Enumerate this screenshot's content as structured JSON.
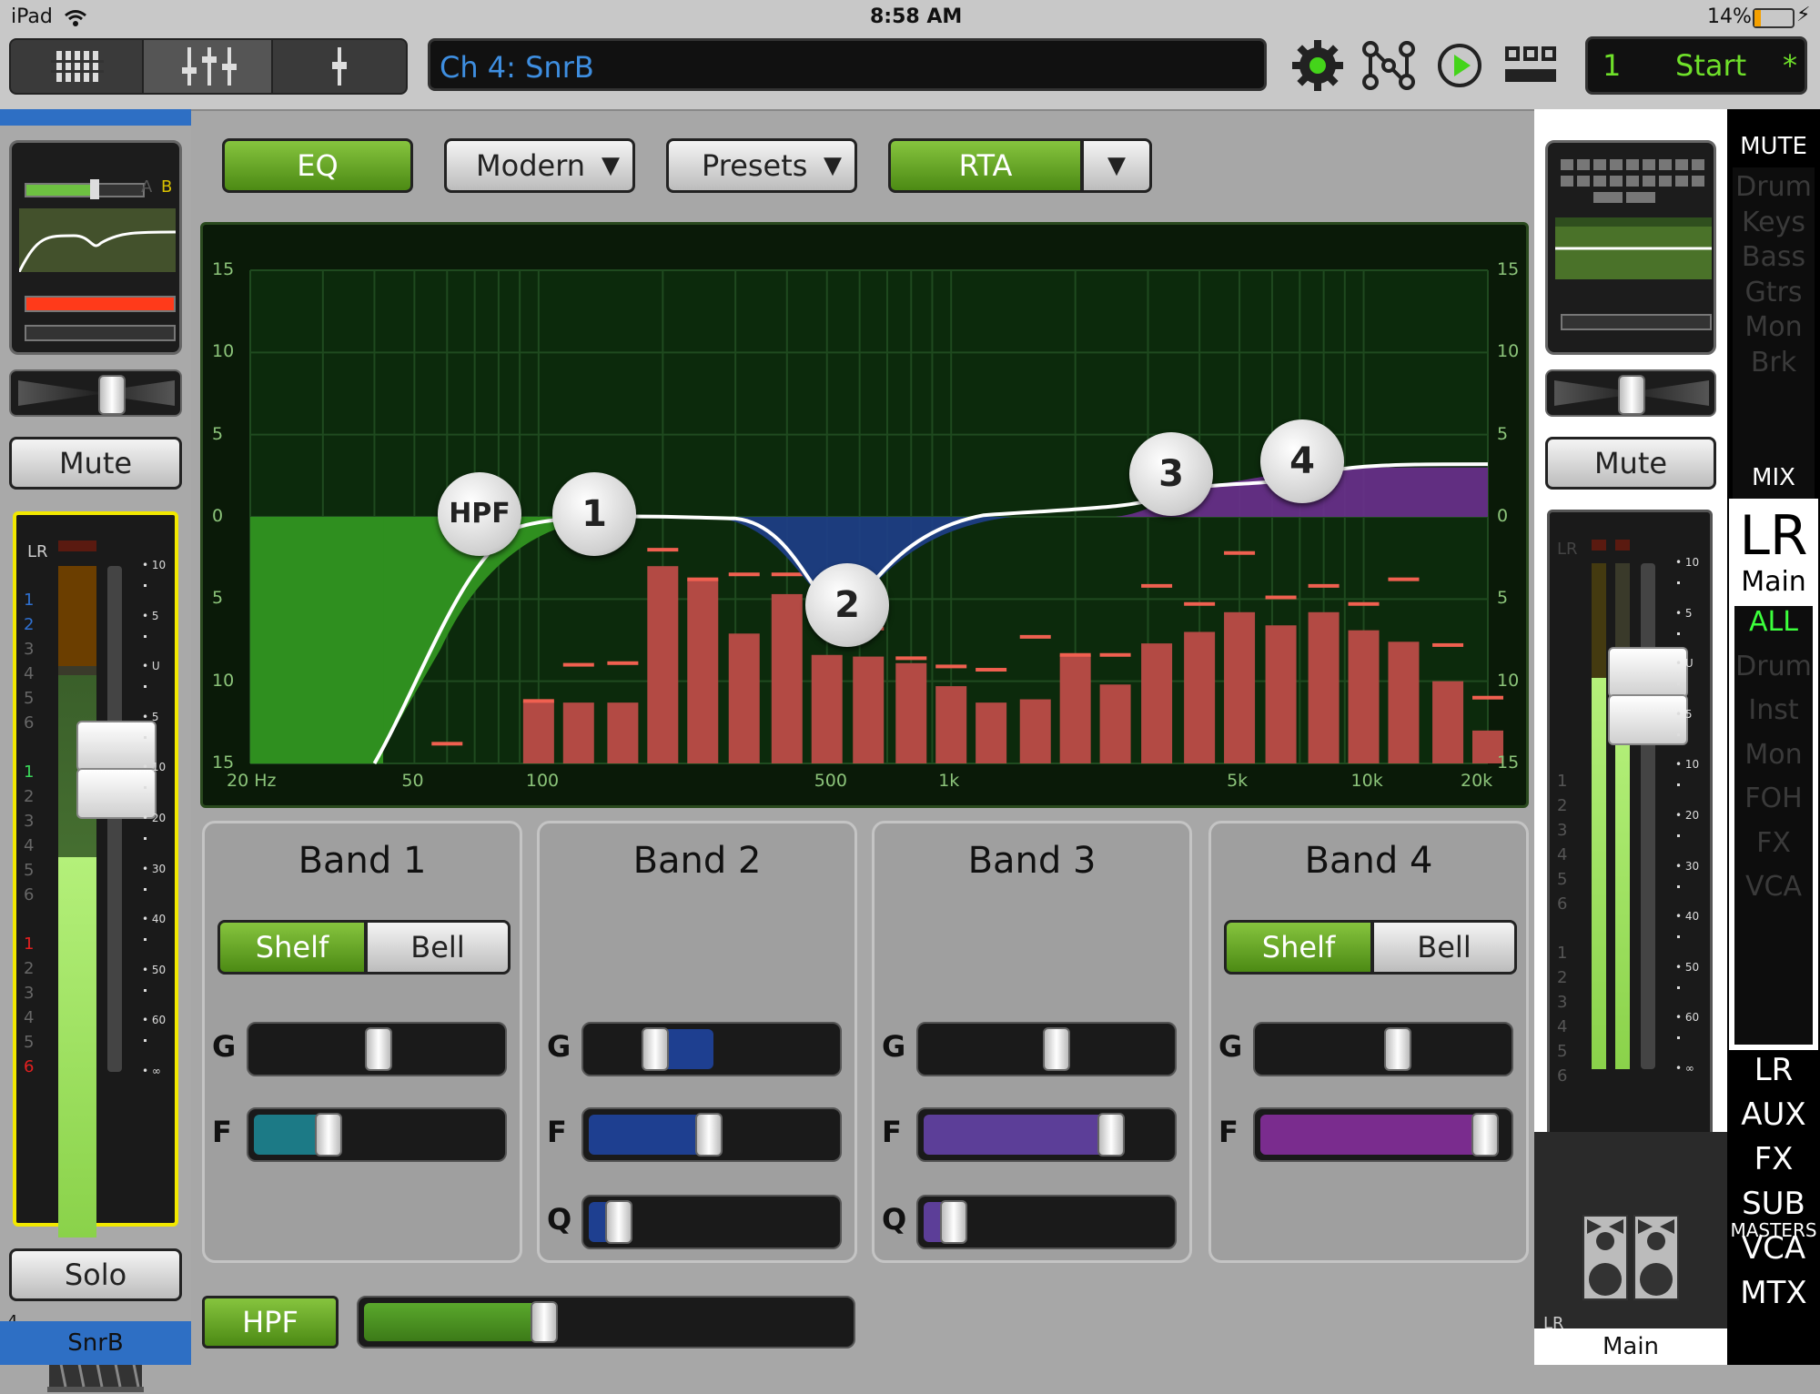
{
  "status": {
    "device": "iPad",
    "time": "8:58 AM",
    "battery": "14%"
  },
  "toolbar": {
    "channel_name": "Ch 4: SnrB",
    "snapshot_number": "1",
    "snapshot_name": "Start",
    "snapshot_modified": "*"
  },
  "eq_header": {
    "eq": "EQ",
    "mode": "Modern",
    "presets": "Presets",
    "rta": "RTA"
  },
  "graph": {
    "y_ticks": [
      "15",
      "10",
      "5",
      "0",
      "5",
      "10",
      "15"
    ],
    "x_ticks": [
      "20 Hz",
      "50",
      "100",
      "500",
      "1k",
      "5k",
      "10k",
      "20k"
    ],
    "nodes": [
      "HPF",
      "1",
      "2",
      "3",
      "4"
    ]
  },
  "rta_bars": [
    {
      "freq": 100,
      "level": -11.2,
      "peak": -11.2
    },
    {
      "freq": 125,
      "level": -11.3,
      "peak": -9.0
    },
    {
      "freq": 160,
      "level": -11.3,
      "peak": -8.9
    },
    {
      "freq": 200,
      "level": -3.0,
      "peak": -2.0
    },
    {
      "freq": 250,
      "level": -3.8,
      "peak": -3.8
    },
    {
      "freq": 315,
      "level": -7.1,
      "peak": -3.5
    },
    {
      "freq": 400,
      "level": -4.7,
      "peak": -3.5
    },
    {
      "freq": 500,
      "level": -8.4,
      "peak": -5.1
    },
    {
      "freq": 630,
      "level": -8.5,
      "peak": -6.8
    },
    {
      "freq": 800,
      "level": -8.9,
      "peak": -8.6
    },
    {
      "freq": 1000,
      "level": -10.3,
      "peak": -9.1
    },
    {
      "freq": 1250,
      "level": -11.3,
      "peak": -9.3
    },
    {
      "freq": 1600,
      "level": -11.1,
      "peak": -7.3
    },
    {
      "freq": 2000,
      "level": -8.4,
      "peak": -8.4
    },
    {
      "freq": 2500,
      "level": -10.2,
      "peak": -8.4
    },
    {
      "freq": 3150,
      "level": -7.7,
      "peak": -4.2
    },
    {
      "freq": 4000,
      "level": -7.0,
      "peak": -5.3
    },
    {
      "freq": 5000,
      "level": -5.8,
      "peak": -2.2
    },
    {
      "freq": 6300,
      "level": -6.6,
      "peak": -4.9
    },
    {
      "freq": 8000,
      "level": -5.8,
      "peak": -4.2
    },
    {
      "freq": 10000,
      "level": -6.9,
      "peak": -5.3
    },
    {
      "freq": 12500,
      "level": -7.6,
      "peak": -3.8
    },
    {
      "freq": 16000,
      "level": -10.0,
      "peak": -7.8
    },
    {
      "freq": 20000,
      "level": -13.0,
      "peak": -11.0
    }
  ],
  "bands": [
    {
      "title": "Band 1",
      "has_shape": true,
      "shape": "Shelf",
      "gain": 0.0,
      "freq": 0.3,
      "q": null
    },
    {
      "title": "Band 2",
      "has_shape": false,
      "gain": -0.45,
      "freq": 0.48,
      "q": 0.12
    },
    {
      "title": "Band 3",
      "has_shape": false,
      "gain": 0.06,
      "freq": 0.75,
      "q": 0.12
    },
    {
      "title": "Band 4",
      "has_shape": true,
      "shape": "Shelf",
      "gain": 0.1,
      "freq": 0.9,
      "q": null
    }
  ],
  "band_labels": {
    "shelf": "Shelf",
    "bell": "Bell",
    "g": "G",
    "f": "F",
    "q": "Q"
  },
  "hpf": {
    "label": "HPF",
    "value": 0.37
  },
  "left_strip": {
    "mute": "Mute",
    "solo": "Solo",
    "channel_number": "4",
    "name": "SnrB",
    "meter_label": "LR",
    "ab_a": "A",
    "ab_b": "B"
  },
  "right_strip": {
    "mute": "Mute",
    "lr_label": "LR",
    "name": "Main"
  },
  "meter_scale": [
    "10",
    "5",
    "U",
    "5",
    "10",
    "20",
    "30",
    "40",
    "50",
    "60",
    "∞"
  ],
  "side_panel": {
    "mute_title": "MUTE",
    "mute_groups": [
      "Drum",
      "Keys",
      "Bass",
      "Gtrs",
      "Mon",
      "Brk"
    ],
    "mix_title": "MIX",
    "mix_lr": "LR",
    "mix_main": "Main",
    "view_groups": [
      "ALL",
      "Drum",
      "Inst",
      "Mon",
      "FOH",
      "FX",
      "VCA"
    ],
    "master_types": [
      "LR",
      "AUX",
      "FX",
      "SUB",
      "VCA",
      "MTX"
    ],
    "masters_title": "MASTERS"
  }
}
